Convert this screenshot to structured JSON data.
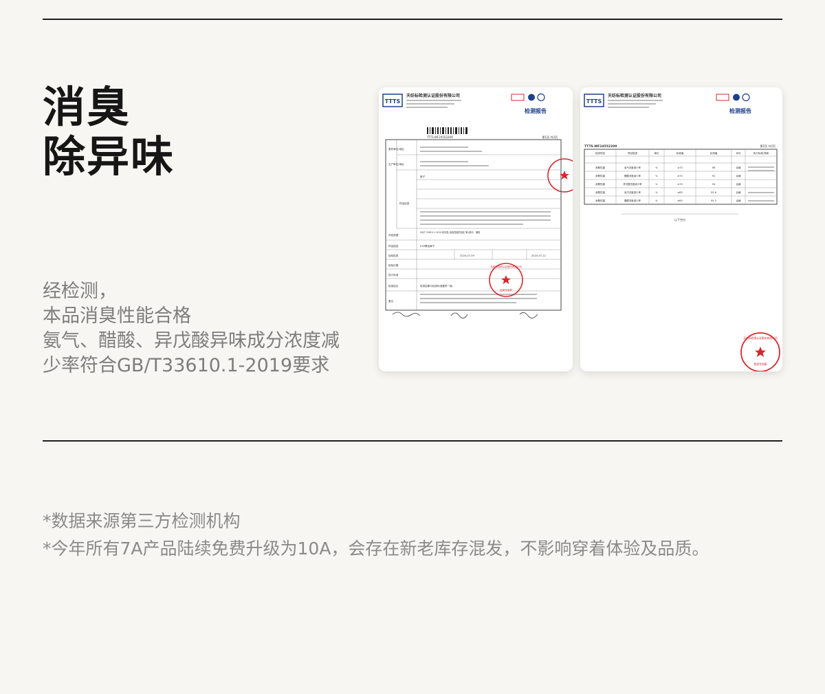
{
  "headline": {
    "line1": "消臭",
    "line2": "除异味"
  },
  "description": {
    "line1": "经检测，",
    "line2": "本品消臭性能合格",
    "line3": "氨气、醋酸、异戊酸异味成分浓度减",
    "line4": "少率符合GB/T33610.1-2019要求"
  },
  "notes": {
    "line1": "*数据来源第三方检测机构",
    "line2": "*今年所有7A产品陆续免费升级为10A，会存在新老库存混发，不影响穿着体验及品质。"
  },
  "report1": {
    "logo": "TTTS",
    "company": "天纺标检测认证股份有限公司",
    "title": "检测报告",
    "report_no": "TTTS-WF24552209",
    "page": "第1页 共2页",
    "row_labels": [
      "委托单位/地址",
      "生产单位/地址",
      "样品信息",
      "判定依据",
      "样品描述",
      "检验性质",
      "检验日期",
      "执行标准",
      "检测结论",
      "备注"
    ],
    "sample_name": "裤子",
    "standard": "GB/T 33610.1-2019 纺织品 消臭性能的测定 第1部分：通则",
    "sample_desc": "E18黑色裤子",
    "dates": [
      "2024-07-09",
      "2024-07-22"
    ],
    "conclusion": "检测结果与检测标准要求一致。",
    "seal_text": "天纺标检测认证股份有限公司",
    "seal_sub": "检测专用章"
  },
  "report2": {
    "logo": "TTTS",
    "company": "天纺标检测认证股份有限公司",
    "title": "检测报告",
    "report_no": "TTTS-WF24552209",
    "page": "第2页 共2页",
    "columns": [
      "检测项目",
      "项目描述",
      "单位",
      "标准值",
      "实测值",
      "评价",
      "执行标准/条款"
    ],
    "rows": [
      {
        "item": "消臭性能",
        "desc": "氨气浓度减少率",
        "unit": "%",
        "std": "≥70",
        "value": "98",
        "eval": "合格"
      },
      {
        "item": "消臭性能",
        "desc": "醋酸浓度减少率",
        "unit": "%",
        "std": "≥70",
        "value": "92",
        "eval": "合格"
      },
      {
        "item": "消臭性能",
        "desc": "异戊酸浓度减少率",
        "unit": "%",
        "std": "≥70",
        "value": "94",
        "eval": "合格"
      },
      {
        "item": "消臭性能",
        "desc": "氨气浓度减少率",
        "unit": "%",
        "std": "≥85",
        "value": "95.6",
        "eval": "合格"
      },
      {
        "item": "消臭性能",
        "desc": "醋酸浓度减少率",
        "unit": "%",
        "std": "≥85",
        "value": "95.2",
        "eval": "合格"
      }
    ],
    "footer": "以下空白",
    "seal_text": "天纺标检测认证股份有限公司",
    "seal_sub": "检测专用章"
  },
  "colors": {
    "background": "#f8f6f2",
    "rule": "#1e1e1e",
    "headline": "#161616",
    "body_text": "#7d7d7d",
    "notes_text": "#8a8a8a",
    "seal": "#d8262b",
    "logo_blue": "#1d3f8c"
  }
}
